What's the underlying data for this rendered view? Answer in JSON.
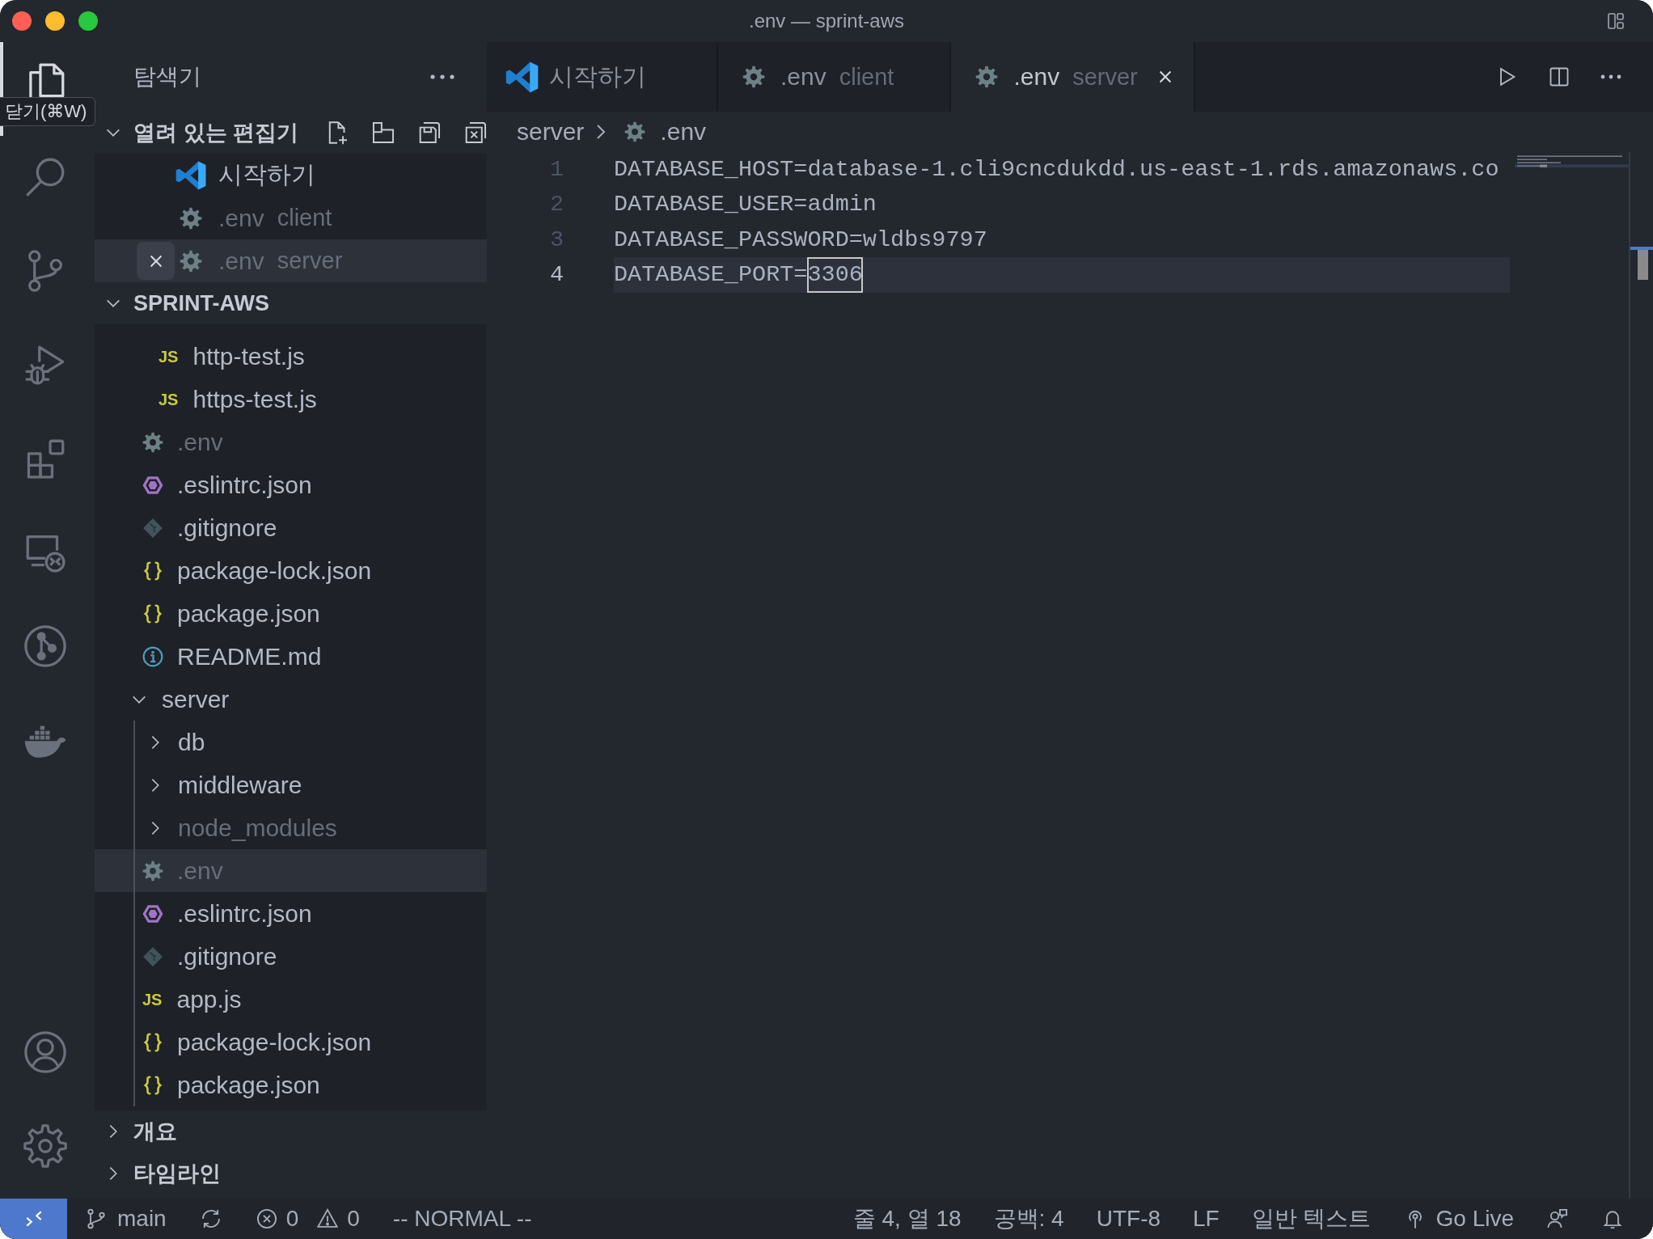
{
  "window": {
    "title": ".env — sprint-aws"
  },
  "activity_bar": {
    "items": [
      {
        "kind": "explorer",
        "selected": true
      },
      {
        "kind": "search",
        "selected": false
      },
      {
        "kind": "source-control",
        "selected": false
      },
      {
        "kind": "run-debug",
        "selected": false
      },
      {
        "kind": "extensions",
        "selected": false
      },
      {
        "kind": "remote",
        "selected": false
      },
      {
        "kind": "git-graph",
        "selected": false
      },
      {
        "kind": "docker",
        "selected": false
      }
    ],
    "bottom_items": [
      {
        "kind": "account"
      },
      {
        "kind": "settings"
      }
    ]
  },
  "tooltip": {
    "text": "닫기(⌘W)"
  },
  "sidebar": {
    "title": "탐색기",
    "open_editors": {
      "title": "열려 있는 편집기",
      "expanded": true,
      "items": [
        {
          "name": "시작하기",
          "kind": "welcome",
          "git_ignored": false,
          "selected": false
        },
        {
          "name": ".env",
          "description": "client",
          "kind": "env",
          "git_ignored": true,
          "selected": false
        },
        {
          "name": ".env",
          "description": "server",
          "kind": "env",
          "git_ignored": true,
          "selected": true
        }
      ]
    },
    "workspace": {
      "title": "SPRINT-AWS",
      "expanded": true,
      "partial_folder_children": [
        {
          "name": "http-test.js",
          "kind": "js",
          "icon_text": "JS",
          "git_ignored": false,
          "selected": false
        },
        {
          "name": "https-test.js",
          "kind": "js",
          "icon_text": "JS",
          "git_ignored": false,
          "selected": false
        }
      ],
      "items": [
        {
          "name": ".env",
          "kind": "env",
          "git_ignored": true,
          "selected": false
        },
        {
          "name": ".eslintrc.json",
          "kind": "eslint",
          "git_ignored": false,
          "selected": false
        },
        {
          "name": ".gitignore",
          "kind": "git",
          "git_ignored": false,
          "selected": false
        },
        {
          "name": "package-lock.json",
          "kind": "json",
          "git_ignored": false,
          "selected": false
        },
        {
          "name": "package.json",
          "kind": "json",
          "git_ignored": false,
          "selected": false
        },
        {
          "name": "README.md",
          "kind": "readme",
          "git_ignored": false,
          "selected": false
        },
        {
          "name": "server",
          "kind": "folder",
          "expanded": true,
          "git_ignored": false,
          "selected": false,
          "children": [
            {
              "name": "db",
              "kind": "folder",
              "expanded": false,
              "git_ignored": false,
              "selected": false
            },
            {
              "name": "middleware",
              "kind": "folder",
              "expanded": false,
              "git_ignored": false,
              "selected": false
            },
            {
              "name": "node_modules",
              "kind": "folder",
              "expanded": false,
              "git_ignored": true,
              "selected": false
            },
            {
              "name": ".env",
              "kind": "env",
              "git_ignored": true,
              "selected": true
            },
            {
              "name": ".eslintrc.json",
              "kind": "eslint",
              "git_ignored": false,
              "selected": false
            },
            {
              "name": ".gitignore",
              "kind": "git",
              "git_ignored": false,
              "selected": false
            },
            {
              "name": "app.js",
              "kind": "js",
              "icon_text": "JS",
              "git_ignored": false,
              "selected": false
            },
            {
              "name": "package-lock.json",
              "kind": "json",
              "git_ignored": false,
              "selected": false
            },
            {
              "name": "package.json",
              "kind": "json",
              "git_ignored": false,
              "selected": false
            }
          ]
        }
      ]
    },
    "more_sections": [
      {
        "title": "개요",
        "expanded": false
      },
      {
        "title": "타임라인",
        "expanded": false
      }
    ]
  },
  "editor": {
    "tabs": [
      {
        "title": "시작하기",
        "kind": "welcome",
        "selected": false
      },
      {
        "title": ".env",
        "description": "client",
        "kind": "env",
        "selected": false
      },
      {
        "title": ".env",
        "description": "server",
        "kind": "env",
        "selected": true
      }
    ],
    "breadcrumbs": [
      {
        "text": "server",
        "kind": "folder"
      },
      {
        "text": ".env",
        "kind": "env"
      }
    ],
    "lines": [
      {
        "number": "1",
        "current": false,
        "segments": [
          {
            "text": "DATABASE_HOST=database-1.cli9cncdukdd.us-east-1.rds.amazonaws.co",
            "boxed": false
          }
        ]
      },
      {
        "number": "2",
        "current": false,
        "segments": [
          {
            "text": "DATABASE_USER=admin",
            "boxed": false
          }
        ]
      },
      {
        "number": "3",
        "current": false,
        "segments": [
          {
            "text": "DATABASE_PASSWORD=wldbs9797",
            "boxed": false
          }
        ]
      },
      {
        "number": "4",
        "current": true,
        "segments": [
          {
            "text": "DATABASE_PORT=",
            "boxed": false
          },
          {
            "text": "3306",
            "boxed": true
          }
        ]
      }
    ]
  },
  "status_bar": {
    "left": [
      {
        "kind": "remote"
      },
      {
        "kind": "branch",
        "text": "main"
      },
      {
        "kind": "sync"
      },
      {
        "kind": "problems",
        "errors": "0",
        "warnings": "0"
      },
      {
        "kind": "text",
        "text": "-- NORMAL --"
      }
    ],
    "right": [
      {
        "kind": "button",
        "text": "줄 4, 열 18"
      },
      {
        "kind": "button",
        "text": "공백: 4"
      },
      {
        "kind": "button",
        "text": "UTF-8"
      },
      {
        "kind": "button",
        "text": "LF"
      },
      {
        "kind": "button",
        "text": "일반 텍스트"
      },
      {
        "kind": "live",
        "text": "Go Live"
      },
      {
        "kind": "feedback"
      },
      {
        "kind": "bell"
      }
    ]
  }
}
